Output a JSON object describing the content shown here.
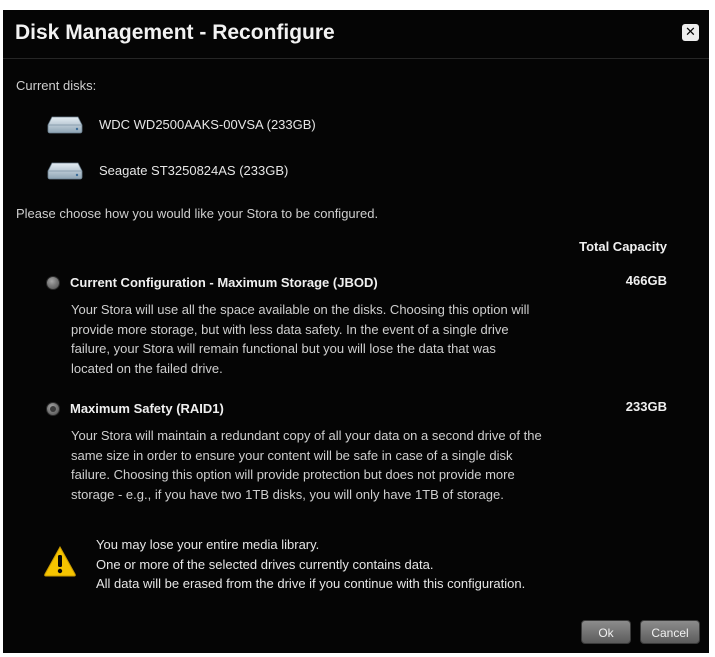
{
  "dialog": {
    "title": "Disk Management - Reconfigure",
    "close_icon": "close-icon"
  },
  "current_disks": {
    "label": "Current disks:",
    "items": [
      {
        "name": "WDC WD2500AAKS-00VSA  (233GB)",
        "icon": "hard-drive-icon"
      },
      {
        "name": "Seagate ST3250824AS  (233GB)",
        "icon": "hard-drive-icon"
      }
    ]
  },
  "prompt": "Please choose how you would like your Stora to be configured.",
  "total_capacity_label": "Total Capacity",
  "options": [
    {
      "title": "Current Configuration - Maximum Storage (JBOD)",
      "capacity": "466GB",
      "lines": [
        "Your Stora will use all the space available on the disks. Choosing this option will",
        "provide more storage, but with less data safety. In the event of a single drive",
        "failure, your Stora will remain functional but you will lose the data that was",
        "located on the failed drive."
      ],
      "selected": false
    },
    {
      "title": "Maximum Safety (RAID1)",
      "capacity": "233GB",
      "lines": [
        "Your Stora will maintain a redundant copy of all your data on a second drive of the",
        "same size in order to ensure your content will be safe in case of a single disk",
        "failure. Choosing this option will provide protection but does not provide more",
        "storage - e.g., if you have two 1TB disks, you will only have 1TB of storage."
      ],
      "selected": true
    }
  ],
  "warning": {
    "icon": "warning-icon",
    "lines": [
      "You may lose your entire media library.",
      "One or more of the selected drives currently contains data.",
      "All data will be erased from the drive if you continue with this configuration."
    ]
  },
  "buttons": {
    "ok": "Ok",
    "cancel": "Cancel"
  },
  "colors": {
    "background": "#050505",
    "warning_yellow": "#f5c400"
  }
}
